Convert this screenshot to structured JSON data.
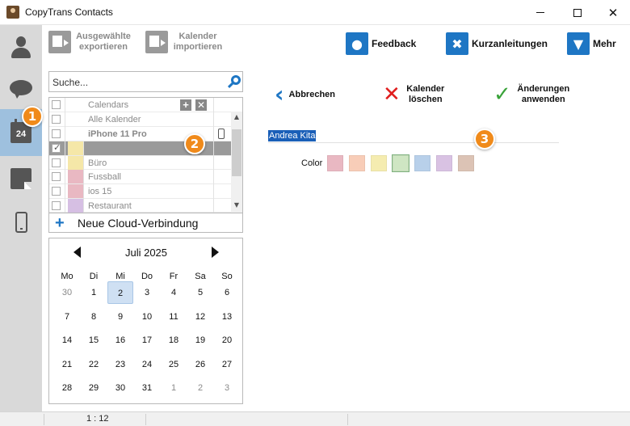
{
  "window": {
    "title": "CopyTrans Contacts"
  },
  "toolbar": {
    "export_label": "Ausgewählte exportieren",
    "import_label": "Kalender importieren",
    "feedback_label": "Feedback",
    "guides_label": "Kurzanleitungen",
    "more_label": "Mehr"
  },
  "nav": {
    "calendar_day": "24"
  },
  "badges": {
    "one": "1",
    "two": "2",
    "three": "3"
  },
  "search": {
    "placeholder": "Suche..."
  },
  "calendar_list": {
    "header": "Calendars",
    "all": "Alle Kalender",
    "device": "iPhone 11 Pro",
    "items": [
      {
        "name": "",
        "color": "#f5e7a8",
        "checked": true,
        "selected": true
      },
      {
        "name": "Büro",
        "color": "#f5e7a8",
        "checked": false,
        "selected": false
      },
      {
        "name": "Fussball",
        "color": "#e9b8c2",
        "checked": false,
        "selected": false
      },
      {
        "name": "ios 15",
        "color": "#e9b8c2",
        "checked": false,
        "selected": false
      },
      {
        "name": "Restaurant",
        "color": "#d6bfe3",
        "checked": false,
        "selected": false
      }
    ]
  },
  "new_cloud_label": "Neue Cloud-Verbindung",
  "month_calendar": {
    "title": "Juli 2025",
    "weekdays": [
      "Mo",
      "Di",
      "Mi",
      "Do",
      "Fr",
      "Sa",
      "So"
    ],
    "weeks": [
      [
        "30",
        "1",
        "2",
        "3",
        "4",
        "5",
        "6"
      ],
      [
        "7",
        "8",
        "9",
        "10",
        "11",
        "12",
        "13"
      ],
      [
        "14",
        "15",
        "16",
        "17",
        "18",
        "19",
        "20"
      ],
      [
        "21",
        "22",
        "23",
        "24",
        "25",
        "26",
        "27"
      ],
      [
        "28",
        "29",
        "30",
        "31",
        "1",
        "2",
        "3"
      ]
    ],
    "today": "2"
  },
  "actions": {
    "cancel_label": "Abbrechen",
    "delete_label": "Kalender löschen",
    "apply_label": "Änderungen anwenden"
  },
  "editor": {
    "name_value": "Andrea Kita",
    "color_label": "Color",
    "colors": [
      "#e9b8c2",
      "#f8cdb8",
      "#f5ecb0",
      "#cfe6c3",
      "#b8d0ea",
      "#d9c2e3",
      "#dcc3b5"
    ],
    "selected_color_index": 3
  },
  "status": {
    "position": "1 : 12"
  }
}
